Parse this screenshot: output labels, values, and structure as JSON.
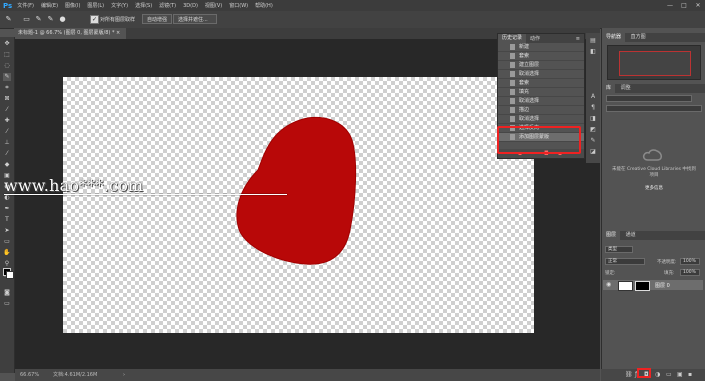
{
  "app": {
    "logo": "Ps"
  },
  "menu": [
    "文件(F)",
    "编辑(E)",
    "图像(I)",
    "图层(L)",
    "文字(Y)",
    "选择(S)",
    "滤镜(T)",
    "3D(D)",
    "视图(V)",
    "窗口(W)",
    "帮助(H)"
  ],
  "window_controls": [
    "—",
    "□",
    "✕"
  ],
  "options": {
    "checkbox_label": "对所有图层取样",
    "button1": "自动增强",
    "button2": "选择并遮住..."
  },
  "document_tab": "未标题-1 @ 66.7% (图层 0, 图层蒙版/8) * ×",
  "watermark": "www.hao***.com",
  "status": {
    "zoom": "66.67%",
    "doc": "文档:4.61M/2.16M"
  },
  "history": {
    "tabs": [
      "历史记录",
      "动作"
    ],
    "items": [
      "新建",
      "套索",
      "建立图层",
      "取消选择",
      "套索",
      "填充",
      "取消选择",
      "描边",
      "取消选择",
      "选择反向",
      "添加图层蒙版"
    ],
    "selected_index": 10,
    "footer_icons": [
      "snapshot-icon",
      "camera-icon",
      "trash-icon"
    ]
  },
  "right": {
    "nav_tabs": [
      "导航器",
      "直方图"
    ],
    "libs_tabs": [
      "库",
      "调整"
    ],
    "cc_text": "未能在 Creative Cloud Libraries 中找到项目",
    "cc_link": "更多信息",
    "layers_tabs": [
      "图层",
      "通道"
    ],
    "kind_label": "类型",
    "blend_mode": "正常",
    "opacity_label": "不透明度:",
    "opacity": "100%",
    "lock_label": "锁定:",
    "fill_label": "填充:",
    "fill": "100%",
    "layer_name": "图层 0"
  },
  "colors": {
    "accent_red": "#e22222",
    "shape_red": "#b80808",
    "ps_blue": "#31a8ff"
  }
}
